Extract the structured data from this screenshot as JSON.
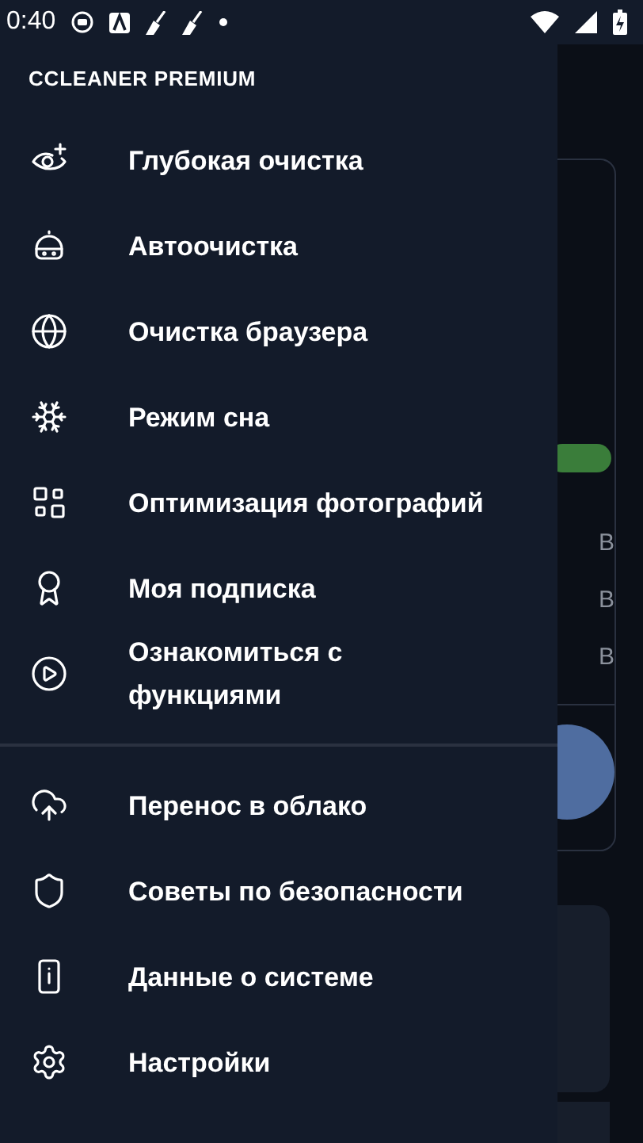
{
  "status_bar": {
    "time": "0:40"
  },
  "drawer": {
    "header": "CCLEANER PREMIUM",
    "primary_items": [
      {
        "label": "Глубокая очистка"
      },
      {
        "label": "Автоочистка"
      },
      {
        "label": "Очистка браузера"
      },
      {
        "label": "Режим сна"
      },
      {
        "label": "Оптимизация фотографий"
      },
      {
        "label": "Моя подписка"
      },
      {
        "label": "Ознакомиться с функциями"
      }
    ],
    "secondary_items": [
      {
        "label": "Перенос в облако"
      },
      {
        "label": "Советы по безопасности"
      },
      {
        "label": "Данные о системе"
      },
      {
        "label": "Настройки"
      }
    ]
  },
  "background": {
    "toggle_on": true,
    "sizes": [
      "B",
      "B",
      "B"
    ]
  }
}
